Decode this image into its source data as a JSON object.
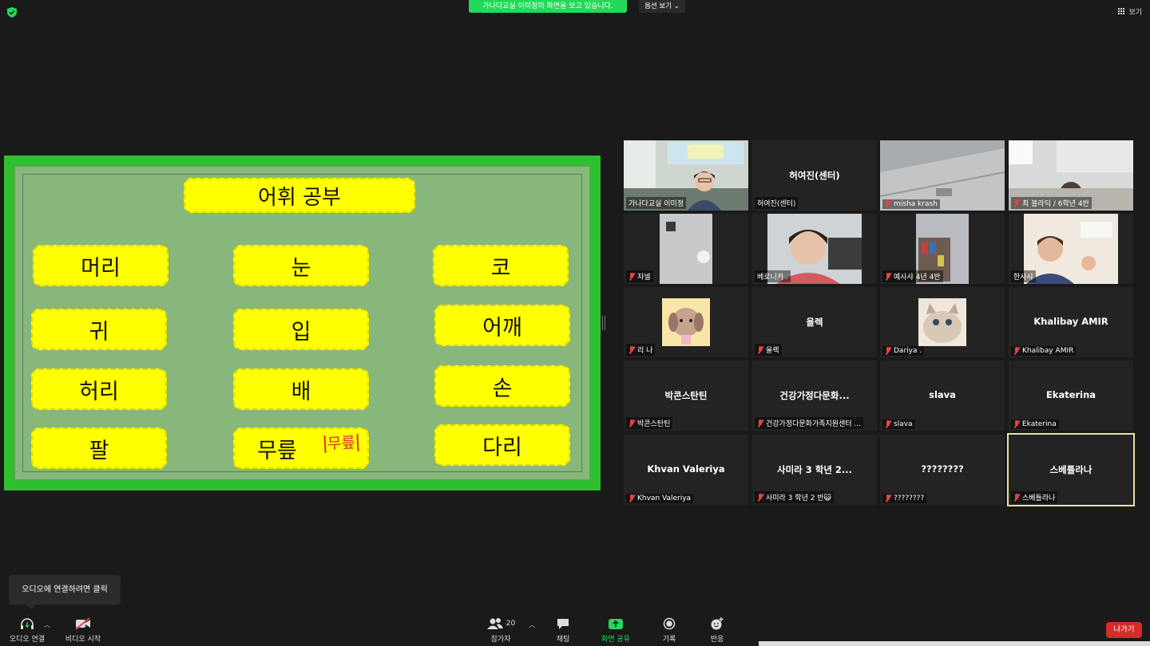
{
  "top": {
    "share_banner": "가나다교실 이미정의 화면을 보고 있습니다.",
    "view_options": "옵션 보기",
    "view_button": "보기"
  },
  "slide": {
    "title": "어휘 공부",
    "words": [
      "머리",
      "눈",
      "코",
      "귀",
      "입",
      "어깨",
      "허리",
      "배",
      "손",
      "팔",
      "무릎",
      "다리"
    ],
    "annotation": "무릎"
  },
  "gallery": {
    "tiles": [
      {
        "label": "가나다교실 이미정",
        "center": "",
        "muted": false,
        "video": "teacher"
      },
      {
        "label": "허여진(센터)",
        "center": "허여진(센터)",
        "muted": false,
        "video": ""
      },
      {
        "label": "misha krash",
        "center": "",
        "muted": true,
        "video": "ceiling"
      },
      {
        "label": "최 블라딕 / 6학년 4반",
        "center": "",
        "muted": true,
        "video": "room"
      },
      {
        "label": "자넬",
        "center": "",
        "muted": true,
        "video": "lamp"
      },
      {
        "label": "베로니카 .",
        "center": "",
        "muted": false,
        "video": "girl"
      },
      {
        "label": "예사샤 4년 4반",
        "center": "",
        "muted": true,
        "video": "shelf"
      },
      {
        "label": "한사샤",
        "center": "",
        "muted": false,
        "video": "boy"
      },
      {
        "label": "리 나",
        "center": "",
        "muted": true,
        "video": "dog"
      },
      {
        "label": "올렉",
        "center": "올렉",
        "muted": true,
        "video": ""
      },
      {
        "label": "Dariya .",
        "center": "",
        "muted": true,
        "video": "cat"
      },
      {
        "label": "Khalibay AMIR",
        "center": "Khalibay AMIR",
        "muted": true,
        "video": ""
      },
      {
        "label": "박콘스탄틴",
        "center": "박콘스탄틴",
        "muted": true,
        "video": ""
      },
      {
        "label": "건강가정다문화가족지원센터 ...",
        "center": "건강가정다문화...",
        "muted": true,
        "video": ""
      },
      {
        "label": "slava",
        "center": "slava",
        "muted": true,
        "video": ""
      },
      {
        "label": "Ekaterina",
        "center": "Ekaterina",
        "muted": true,
        "video": ""
      },
      {
        "label": "Khvan Valeriya",
        "center": "Khvan Valeriya",
        "muted": true,
        "video": ""
      },
      {
        "label": "사미라 3 학년 2 반😺",
        "center": "사미라 3 학년 2...",
        "muted": true,
        "video": ""
      },
      {
        "label": "????????",
        "center": "????????",
        "muted": true,
        "video": ""
      },
      {
        "label": "스베틀라나",
        "center": "스베틀라나",
        "muted": true,
        "video": "",
        "active": true
      }
    ]
  },
  "toolbar": {
    "tooltip": "오디오에 연결하려면 클릭",
    "audio": "오디오 연결",
    "video": "비디오 시작",
    "participants": "참가자",
    "participants_count": "20",
    "chat": "채팅",
    "share": "화면 공유",
    "record": "기록",
    "reactions": "반응",
    "leave": "나가기"
  },
  "colors": {
    "accent_green": "#23d959",
    "leave_red": "#d42b2b",
    "card_yellow": "#ffff00",
    "slide_green": "#2fbf2f"
  }
}
